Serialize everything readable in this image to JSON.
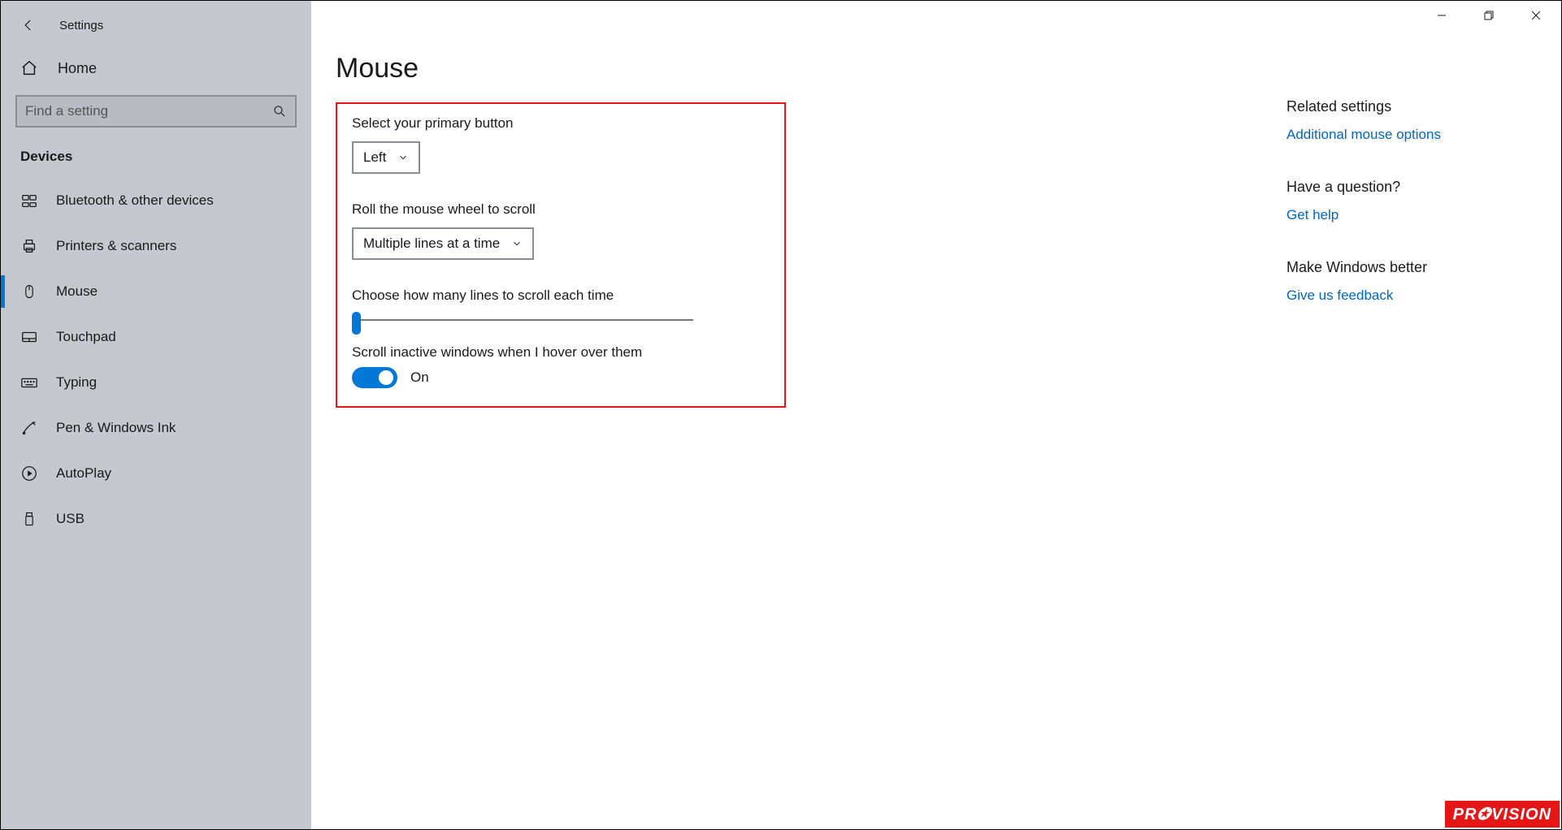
{
  "window": {
    "title": "Settings"
  },
  "sidebar": {
    "home_label": "Home",
    "search_placeholder": "Find a setting",
    "category": "Devices",
    "items": [
      {
        "label": "Bluetooth & other devices"
      },
      {
        "label": "Printers & scanners"
      },
      {
        "label": "Mouse"
      },
      {
        "label": "Touchpad"
      },
      {
        "label": "Typing"
      },
      {
        "label": "Pen & Windows Ink"
      },
      {
        "label": "AutoPlay"
      },
      {
        "label": "USB"
      }
    ]
  },
  "page": {
    "title": "Mouse",
    "primary_button": {
      "label": "Select your primary button",
      "value": "Left"
    },
    "wheel_scroll": {
      "label": "Roll the mouse wheel to scroll",
      "value": "Multiple lines at a time"
    },
    "lines_scroll": {
      "label": "Choose how many lines to scroll each time"
    },
    "inactive_hover": {
      "label": "Scroll inactive windows when I hover over them",
      "state": "On"
    }
  },
  "right": {
    "related": {
      "heading": "Related settings",
      "link": "Additional mouse options"
    },
    "question": {
      "heading": "Have a question?",
      "link": "Get help"
    },
    "feedback": {
      "heading": "Make Windows better",
      "link": "Give us feedback"
    }
  },
  "watermark": "PR  VISION"
}
